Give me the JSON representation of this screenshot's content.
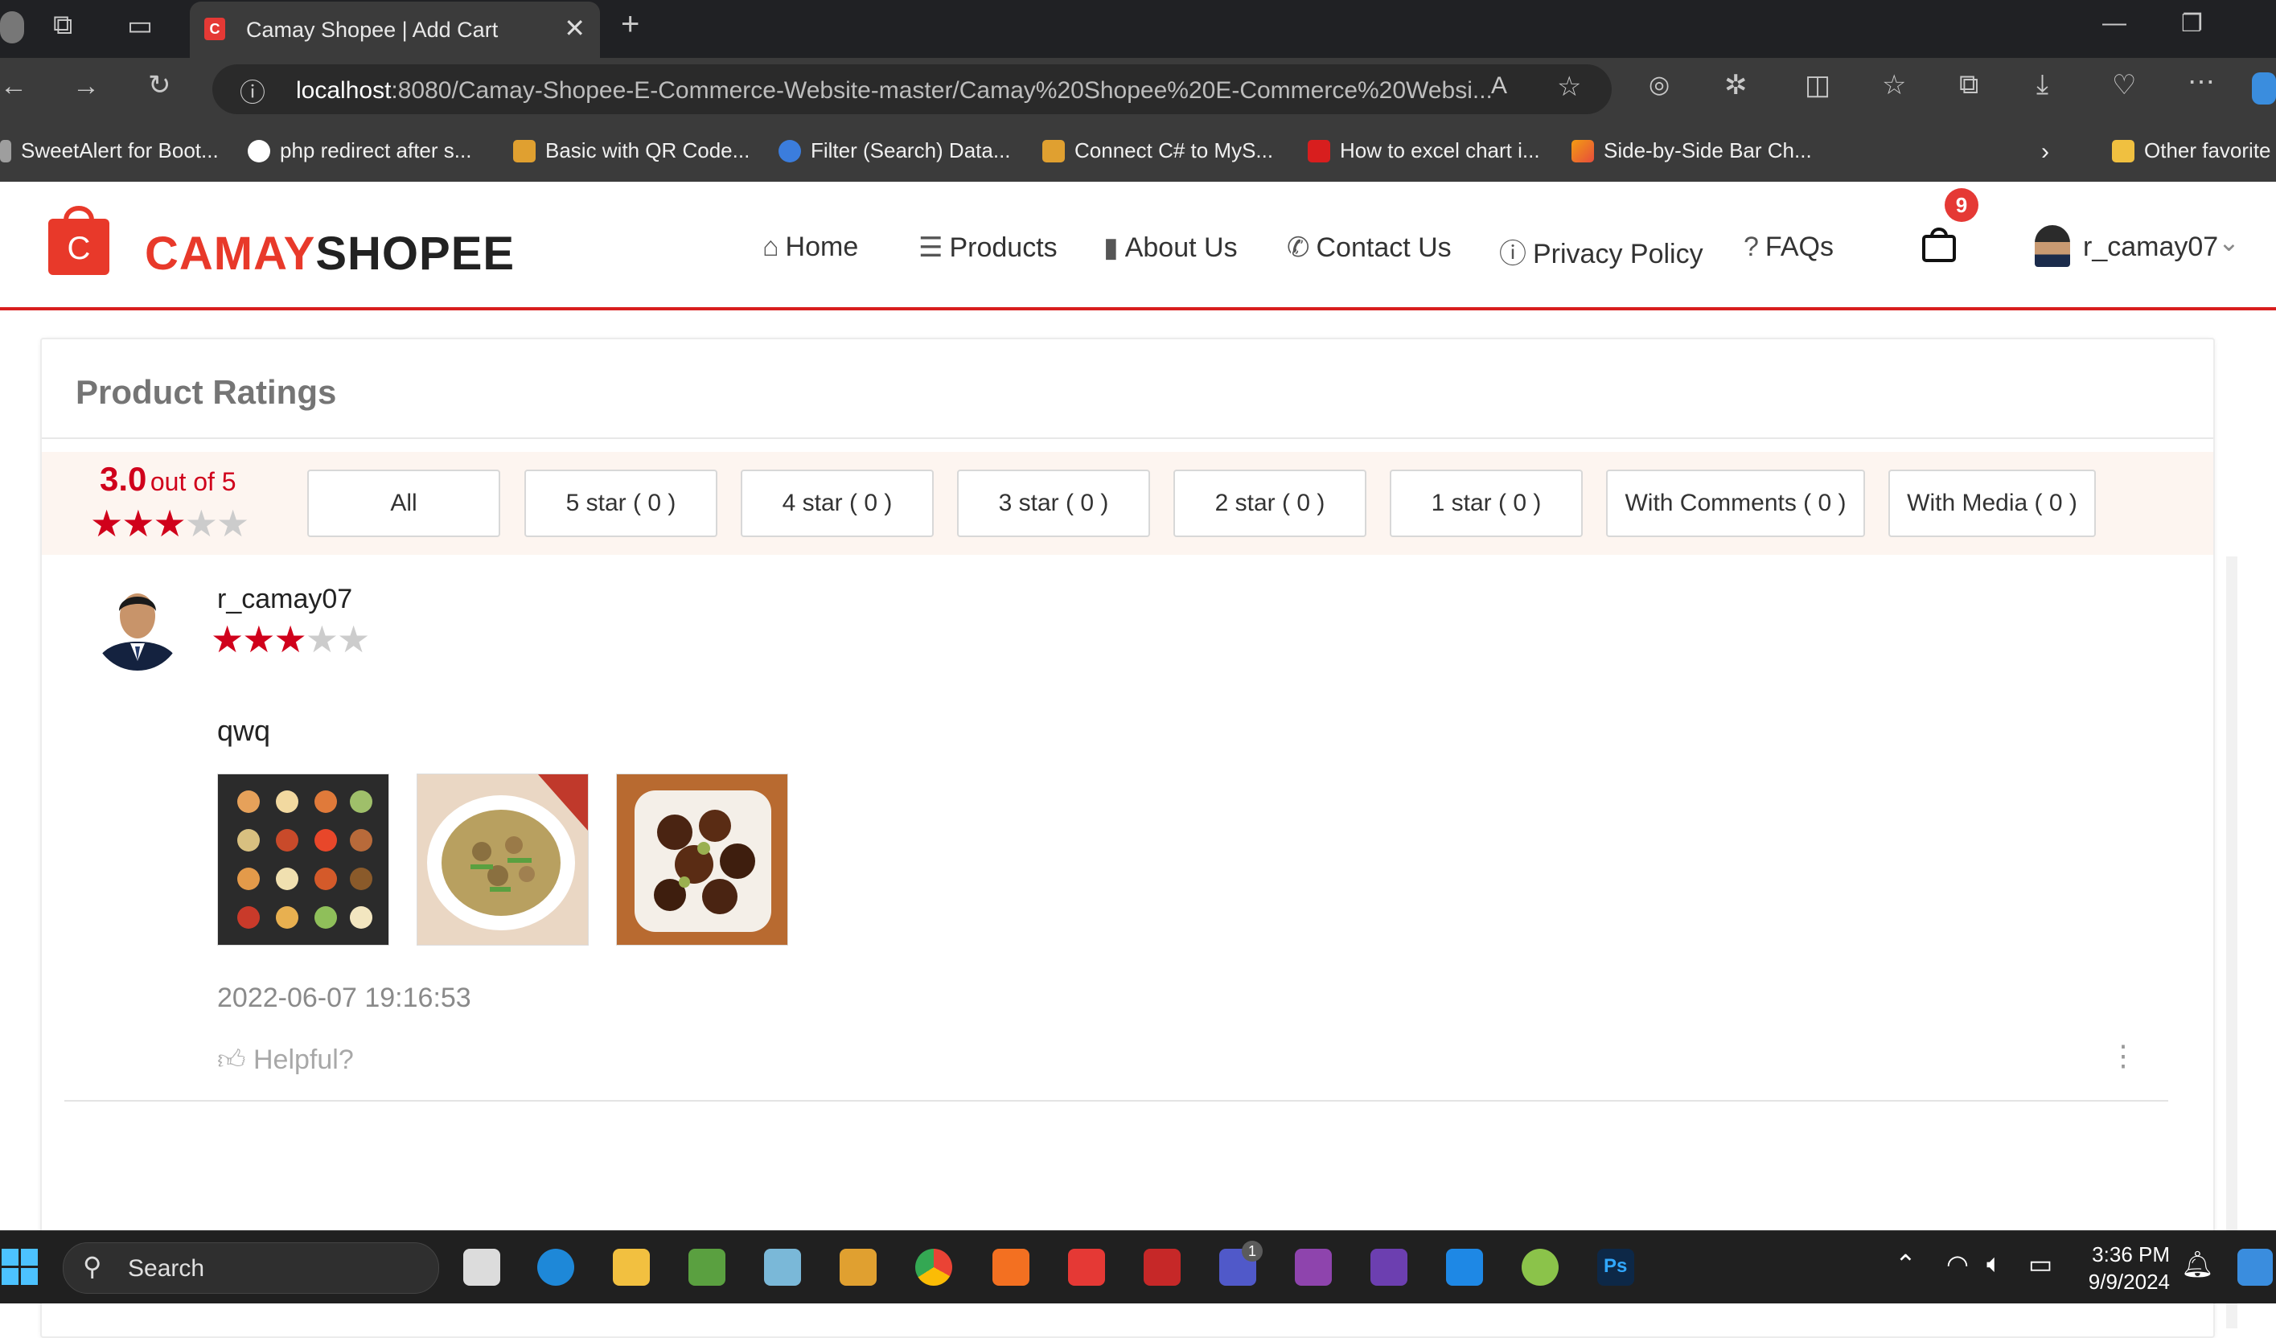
{
  "browser": {
    "tab_title": "Camay Shopee | Add Cart",
    "url_host": "localhost",
    "url_rest": ":8080/Camay-Shopee-E-Commerce-Website-master/Camay%20Shopee%20E-Commerce%20Websi...",
    "bookmarks": [
      "SweetAlert for Boot...",
      "php redirect after s...",
      "Basic with QR Code...",
      "Filter (Search) Data...",
      "Connect C# to MyS...",
      "How to excel chart i...",
      "Side-by-Side Bar Ch...",
      "Other favorite"
    ]
  },
  "site": {
    "brand_red": "CAMAY",
    "brand_dark": "SHOPEE",
    "logo_letter": "C",
    "nav": [
      "Home",
      "Products",
      "About Us",
      "Contact Us",
      "Privacy Policy",
      "FAQs"
    ],
    "cart_count": "9",
    "username": "r_camay07"
  },
  "ratings": {
    "title": "Product Ratings",
    "score": "3.0",
    "score_suffix": "out of 5",
    "score_value": 3,
    "filters": [
      "All",
      "5 star ( 0 )",
      "4 star ( 0 )",
      "3 star ( 0 )",
      "2 star ( 0 )",
      "1 star ( 0 )",
      "With Comments ( 0 )",
      "With Media ( 0 )"
    ]
  },
  "review": {
    "user": "r_camay07",
    "stars": 3,
    "comment": "qwq",
    "timestamp": "2022-06-07 19:16:53",
    "helpful_label": "Helpful?"
  },
  "taskbar": {
    "search_label": "Search",
    "time": "3:36 PM",
    "date": "9/9/2024",
    "teams_badge": "1"
  },
  "colors": {
    "accent_red": "#d0011b",
    "brand_red": "#e8392a",
    "header_rule": "#d81e1e",
    "overview_bg": "#fdf5f0"
  }
}
